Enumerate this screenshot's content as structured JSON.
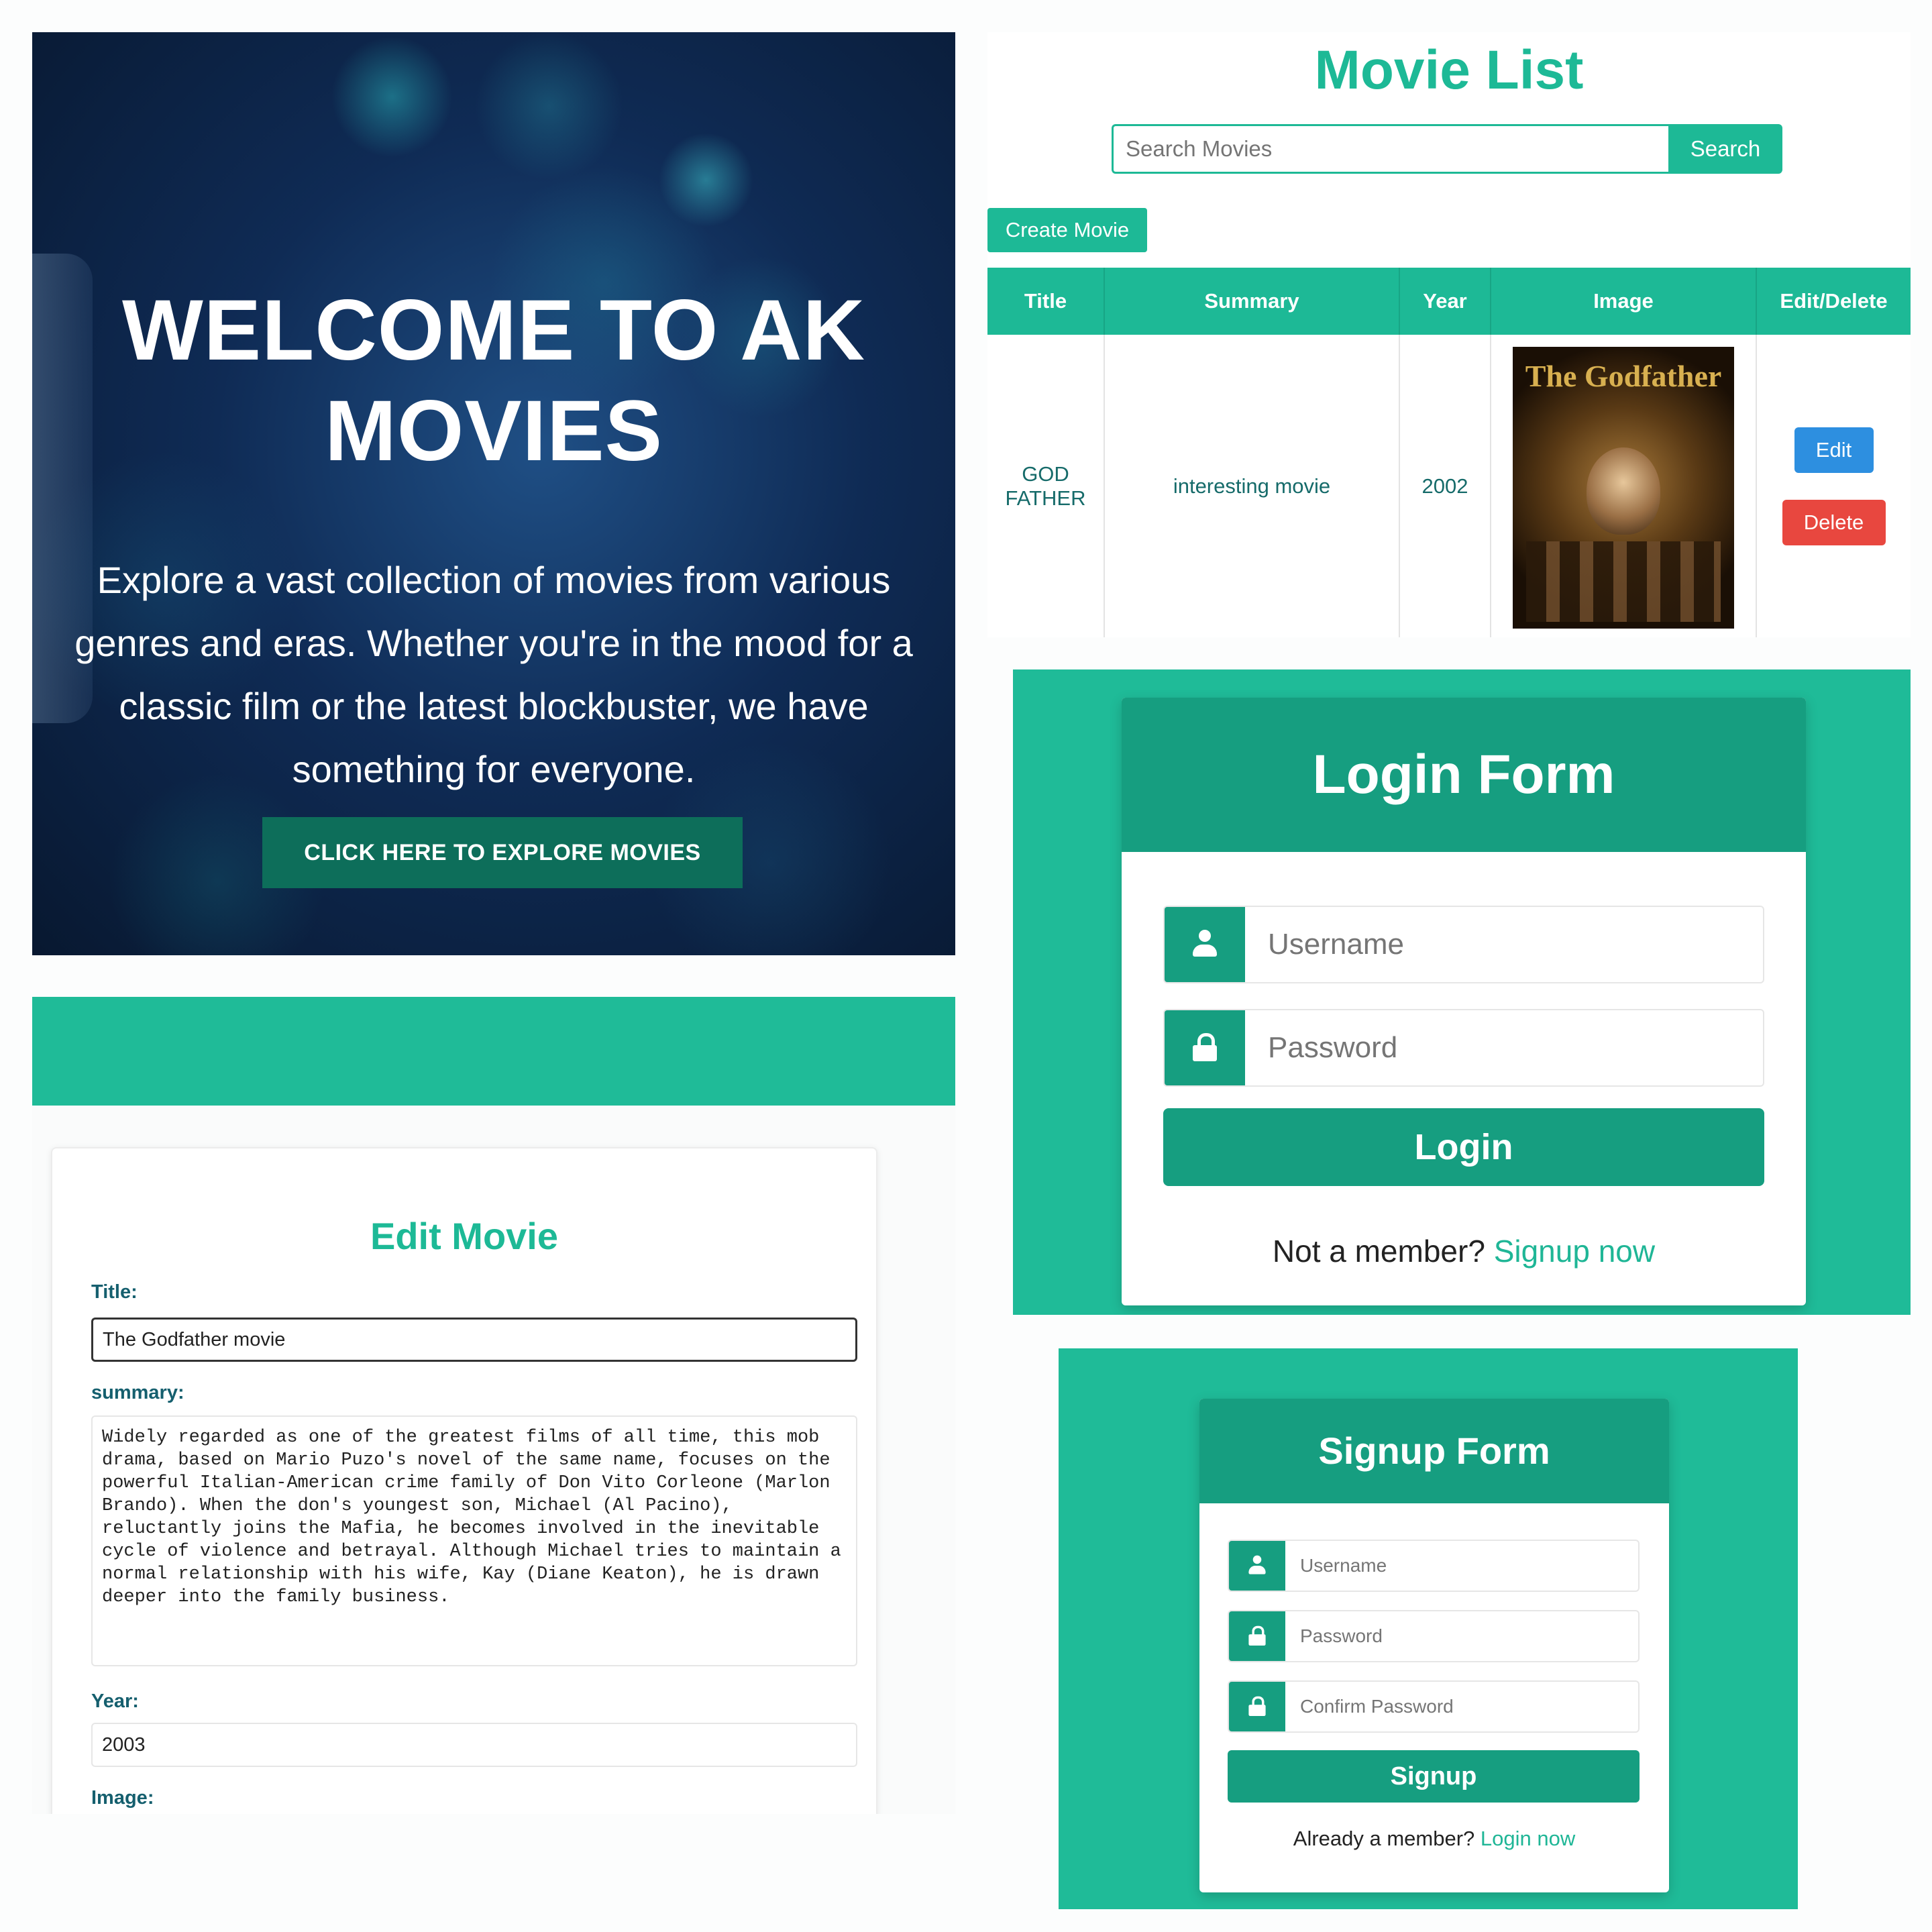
{
  "hero": {
    "title": "WELCOME TO AK MOVIES",
    "text": "Explore a vast collection of movies from various genres and eras. Whether you're in the mood for a classic film or the latest blockbuster, we have something for everyone.",
    "cta": "CLICK HERE TO EXPLORE MOVIES"
  },
  "movie_list": {
    "title": "Movie List",
    "search_placeholder": "Search Movies",
    "search_button": "Search",
    "create_button": "Create Movie",
    "columns": [
      "Title",
      "Summary",
      "Year",
      "Image",
      "Edit/Delete"
    ],
    "rows": [
      {
        "title": "GOD FATHER",
        "summary": "interesting movie",
        "year": "2002",
        "image": "The Godfather",
        "edit": "Edit",
        "delete": "Delete"
      }
    ]
  },
  "login": {
    "title": "Login Form",
    "username_placeholder": "Username",
    "password_placeholder": "Password",
    "button": "Login",
    "footer_text": "Not a member? ",
    "footer_link": "Signup now"
  },
  "signup": {
    "title": "Signup Form",
    "username_placeholder": "Username",
    "password_placeholder": "Password",
    "confirm_placeholder": "Confirm Password",
    "button": "Signup",
    "footer_text": "Already a member? ",
    "footer_link": "Login now"
  },
  "edit_movie": {
    "title": "Edit Movie",
    "title_label": "Title:",
    "title_value": "The Godfather movie",
    "summary_label": "summary:",
    "summary_value": "Widely regarded as one of the greatest films of all time, this mob drama, based on Mario Puzo's novel of the same name, focuses on the powerful Italian-American crime family of Don Vito Corleone (Marlon Brando). When the don's youngest son, Michael (Al Pacino), reluctantly joins the Mafia, he becomes involved in the inevitable cycle of violence and betrayal. Although Michael tries to maintain a normal relationship with his wife, Kay (Diane Keaton), he is drawn deeper into the family business.",
    "year_label": "Year:",
    "year_value": "2003",
    "image_label": "Image:"
  },
  "colors": {
    "accent": "#1db996",
    "accent_dark": "#169e80",
    "edit_blue": "#2d8fe0",
    "delete_red": "#e8473f"
  }
}
